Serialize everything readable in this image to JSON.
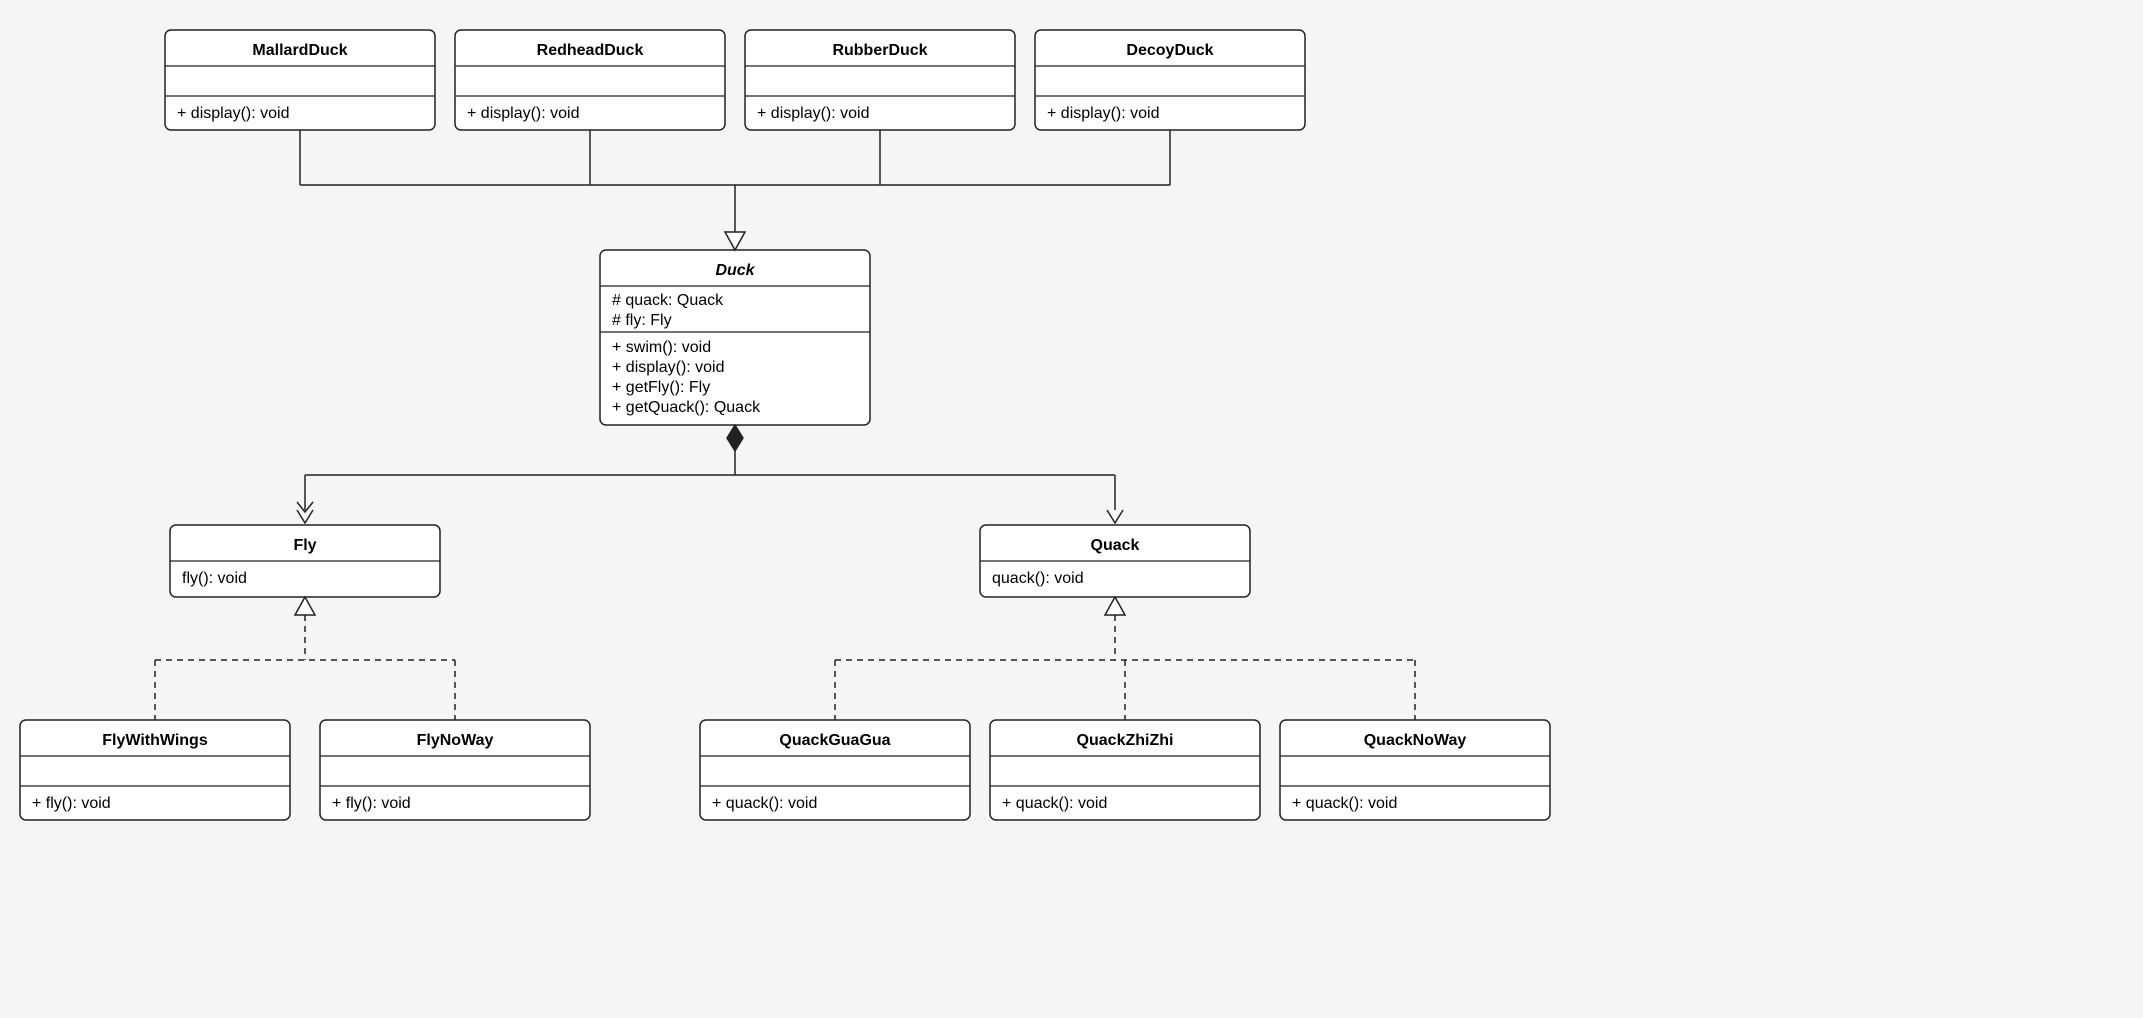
{
  "diagram": {
    "type": "uml-class-diagram",
    "classes": {
      "MallardDuck": {
        "name": "MallardDuck",
        "methods": [
          "+ display(): void"
        ]
      },
      "RedheadDuck": {
        "name": "RedheadDuck",
        "methods": [
          "+ display(): void"
        ]
      },
      "RubberDuck": {
        "name": "RubberDuck",
        "methods": [
          "+ display(): void"
        ]
      },
      "DecoyDuck": {
        "name": "DecoyDuck",
        "methods": [
          "+ display(): void"
        ]
      },
      "Duck": {
        "name": "Duck",
        "abstract": true,
        "attributes": [
          "# quack: Quack",
          "# fly: Fly"
        ],
        "methods": [
          "+ swim(): void",
          "+ display(): void",
          "+ getFly(): Fly",
          "+ getQuack(): Quack"
        ],
        "abstractMethods": [
          "display"
        ]
      },
      "Fly": {
        "name": "Fly",
        "methods": [
          "fly(): void"
        ]
      },
      "Quack": {
        "name": "Quack",
        "methods": [
          "quack(): void"
        ]
      },
      "FlyWithWings": {
        "name": "FlyWithWings",
        "methods": [
          "+ fly(): void"
        ]
      },
      "FlyNoWay": {
        "name": "FlyNoWay",
        "methods": [
          "+ fly(): void"
        ]
      },
      "QuackGuaGua": {
        "name": "QuackGuaGua",
        "methods": [
          "+ quack(): void"
        ]
      },
      "QuackZhiZhi": {
        "name": "QuackZhiZhi",
        "methods": [
          "+ quack(): void"
        ]
      },
      "QuackNoWay": {
        "name": "QuackNoWay",
        "methods": [
          "+ quack(): void"
        ]
      }
    },
    "relationships": [
      {
        "from": "MallardDuck",
        "to": "Duck",
        "type": "generalization"
      },
      {
        "from": "RedheadDuck",
        "to": "Duck",
        "type": "generalization"
      },
      {
        "from": "RubberDuck",
        "to": "Duck",
        "type": "generalization"
      },
      {
        "from": "DecoyDuck",
        "to": "Duck",
        "type": "generalization"
      },
      {
        "from": "Duck",
        "to": "Fly",
        "type": "composition"
      },
      {
        "from": "Duck",
        "to": "Quack",
        "type": "composition"
      },
      {
        "from": "FlyWithWings",
        "to": "Fly",
        "type": "realization"
      },
      {
        "from": "FlyNoWay",
        "to": "Fly",
        "type": "realization"
      },
      {
        "from": "QuackGuaGua",
        "to": "Quack",
        "type": "realization"
      },
      {
        "from": "QuackZhiZhi",
        "to": "Quack",
        "type": "realization"
      },
      {
        "from": "QuackNoWay",
        "to": "Quack",
        "type": "realization"
      }
    ]
  }
}
